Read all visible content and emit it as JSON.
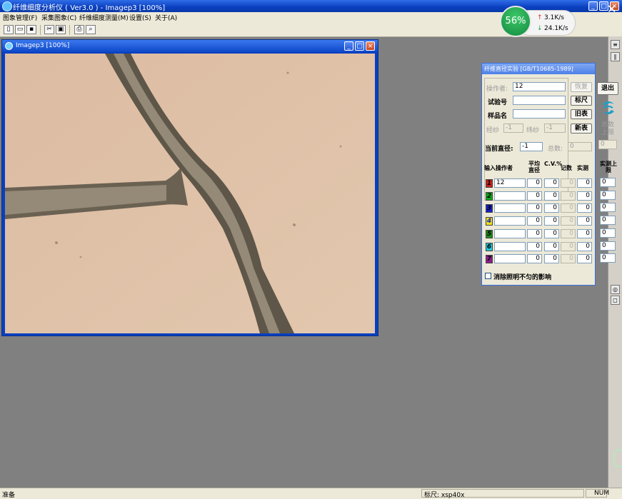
{
  "app": {
    "title": "纤维细度分析仪 ( Ver3.0 ) - Imagep3 [100%]",
    "menu": [
      "图象管理(F)",
      "采集图象(C)",
      "纤维细度测量(M)",
      "设置(S)",
      "关于(A)"
    ]
  },
  "network": {
    "percent": "56%",
    "upload": "3.1K/s",
    "download": "24.1K/s"
  },
  "image_window": {
    "title": "Imagep3 [100%]"
  },
  "dialog": {
    "title": "纤维直径实验 [GB/T10685-1989]",
    "operator_label": "操作者:",
    "operator_value": "12",
    "test_no_label": "试验号",
    "sample_label": "样品名",
    "warp_label": "经纱",
    "warp_value": "-1",
    "weft_label": "纬纱",
    "weft_value": "-1",
    "current_dia_label": "当前直径:",
    "current_dia_value": "-1",
    "total_label": "总数:",
    "total_value": "0",
    "buttons": {
      "restore": "恢复",
      "scale": "标尺",
      "old_table": "旧表",
      "new_table": "新表",
      "exit": "退出"
    },
    "total_limit_label": "总数上限",
    "total_limit_value": "0",
    "columns": [
      "输入操作者",
      "平均直径",
      "C.V.%",
      "记数",
      "实测",
      "实测上限"
    ],
    "rows": [
      {
        "num": "1",
        "color": "#c8201e",
        "op": "12",
        "avg": "0",
        "cv": "0",
        "count": "0",
        "meas": "0",
        "limit": "0"
      },
      {
        "num": "2",
        "color": "#0ea81e",
        "op": "",
        "avg": "0",
        "cv": "0",
        "count": "0",
        "meas": "0",
        "limit": "0"
      },
      {
        "num": "3",
        "color": "#1420c8",
        "op": "",
        "avg": "0",
        "cv": "0",
        "count": "0",
        "meas": "0",
        "limit": "0"
      },
      {
        "num": "4",
        "color": "#e8e020",
        "op": "",
        "avg": "0",
        "cv": "0",
        "count": "0",
        "meas": "0",
        "limit": "0"
      },
      {
        "num": "5",
        "color": "#1e8a1e",
        "op": "",
        "avg": "0",
        "cv": "0",
        "count": "0",
        "meas": "0",
        "limit": "0"
      },
      {
        "num": "6",
        "color": "#20c8d8",
        "op": "",
        "avg": "0",
        "cv": "0",
        "count": "0",
        "meas": "0",
        "limit": "0"
      },
      {
        "num": "7",
        "color": "#8a1e8a",
        "op": "",
        "avg": "0",
        "cv": "0",
        "count": "0",
        "meas": "0",
        "limit": "0"
      }
    ],
    "checkbox_label": "消除照明不匀的影响"
  },
  "status": {
    "left": "准备",
    "scale": "标尺: xsp40x",
    "mode": "NUM"
  }
}
